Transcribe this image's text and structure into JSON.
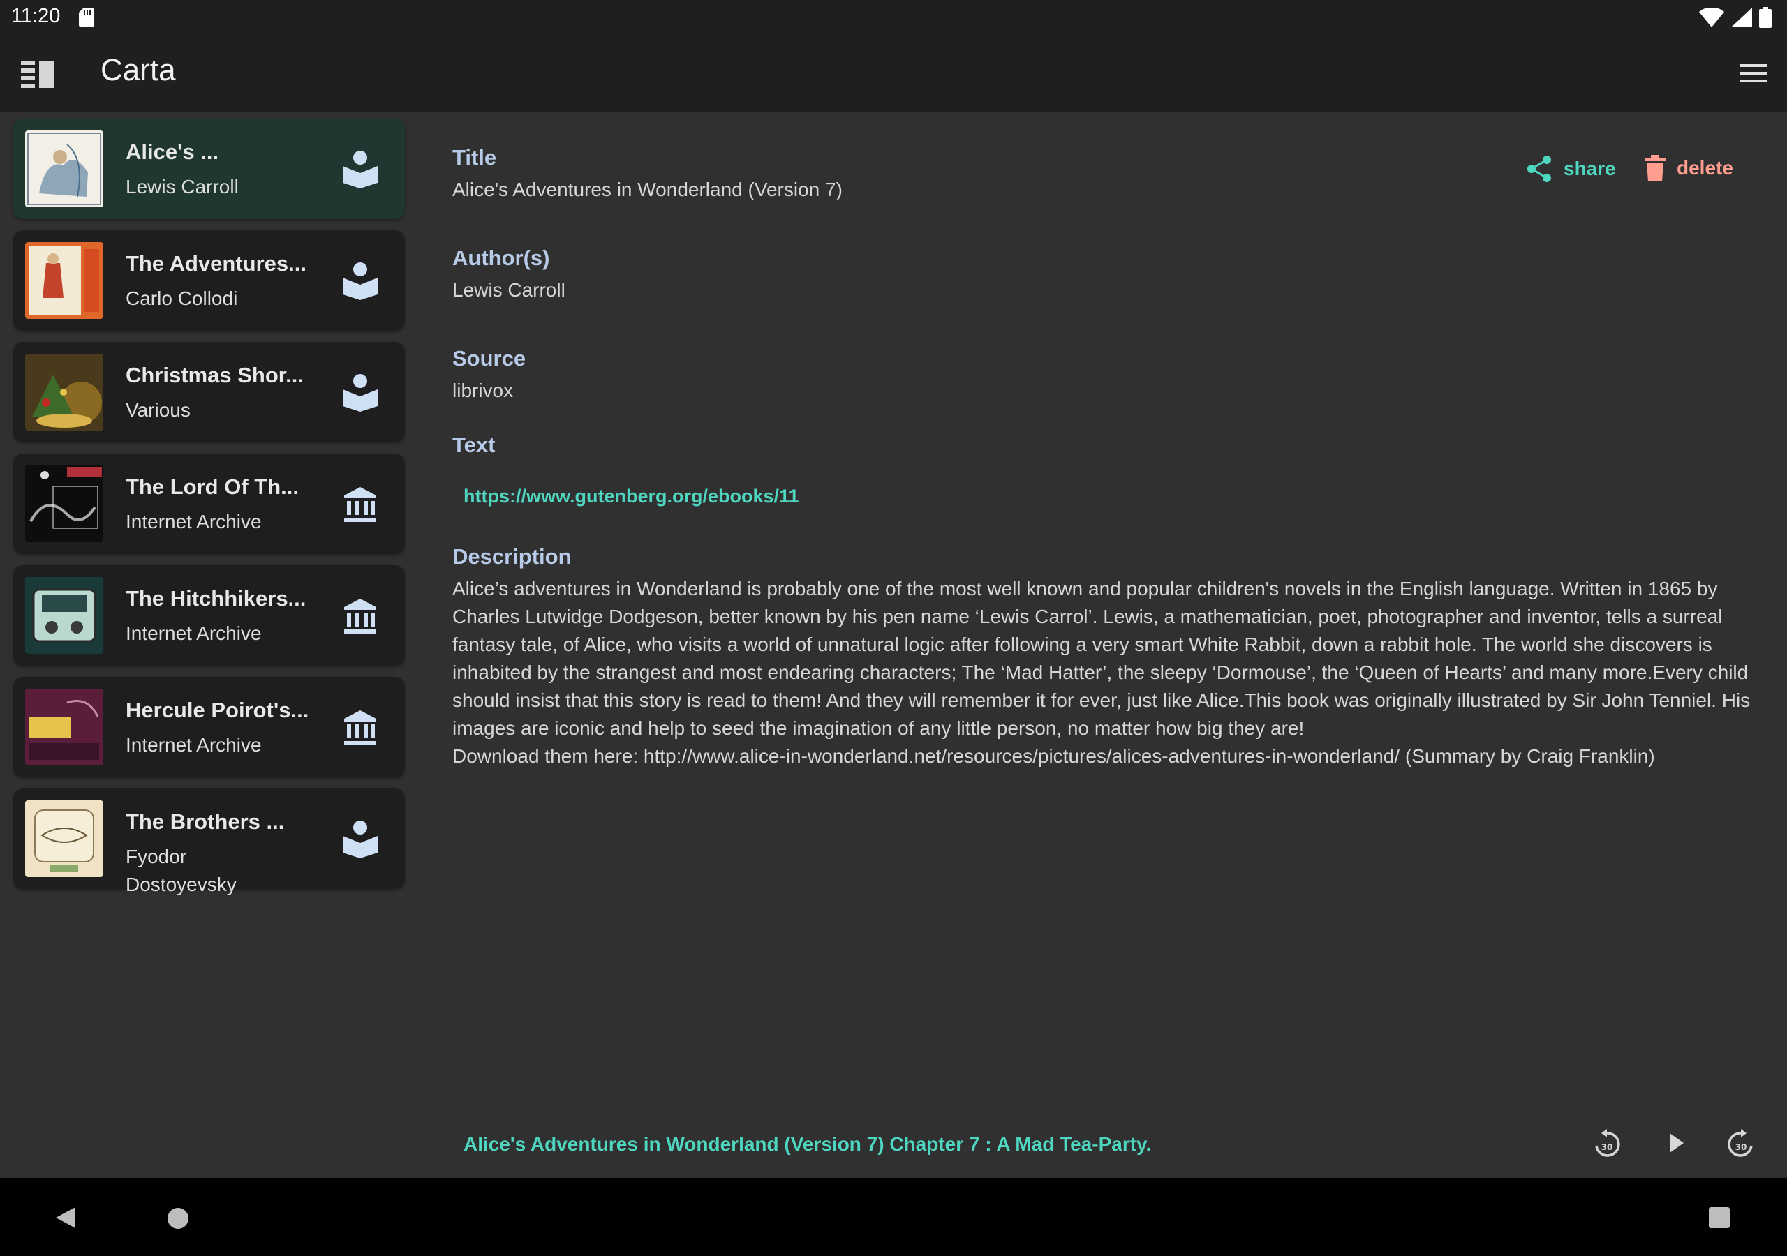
{
  "status_bar": {
    "time": "11:20"
  },
  "app_bar": {
    "title": "Carta"
  },
  "books": [
    {
      "title": "Alice's ...",
      "subtitle": "Lewis Carroll",
      "source_icon": "reader-icon",
      "selected": true
    },
    {
      "title": "The Adventures...",
      "subtitle": "Carlo Collodi",
      "source_icon": "reader-icon",
      "selected": false
    },
    {
      "title": "Christmas Shor...",
      "subtitle": "Various",
      "source_icon": "reader-icon",
      "selected": false
    },
    {
      "title": "The Lord Of Th...",
      "subtitle": "Internet Archive",
      "source_icon": "archive-icon",
      "selected": false
    },
    {
      "title": "The Hitchhikers...",
      "subtitle": "Internet Archive",
      "source_icon": "archive-icon",
      "selected": false
    },
    {
      "title": "Hercule Poirot's...",
      "subtitle": "Internet Archive",
      "source_icon": "archive-icon",
      "selected": false
    },
    {
      "title": "The Brothers ...",
      "subtitle": "Fyodor Dostoyevsky",
      "source_icon": "reader-icon",
      "selected": false
    }
  ],
  "detail": {
    "title_label": "Title",
    "title_value": "Alice's Adventures in Wonderland (Version 7)",
    "authors_label": "Author(s)",
    "authors_value": "Lewis Carroll",
    "source_label": "Source",
    "source_value": "librivox",
    "text_label": "Text",
    "text_link": "https://www.gutenberg.org/ebooks/11",
    "description_label": "Description",
    "description_value": "Alice’s adventures in Wonderland is probably one of the most well known and popular children's novels in the English language. Written in 1865 by Charles Lutwidge Dodgeson, better known by his pen name ‘Lewis Carrol’. Lewis, a mathematician, poet, photographer and inventor, tells a surreal fantasy tale, of Alice, who visits a world of unnatural logic after following a very smart White Rabbit, down a rabbit hole. The world she discovers is inhabited by the strangest and most endearing characters; The ‘Mad Hatter’, the sleepy ‘Dormouse’, the ‘Queen of Hearts’ and many more.Every child should insist that this story is read to them! And they will remember it for ever, just like Alice.This book was originally illustrated by Sir John Tenniel. His images are iconic and help to seed the imagination of any little person, no matter how big they are!\nDownload them here: http://www.alice-in-wonderland.net/resources/pictures/alices-adventures-in-wonderland/ (Summary by Craig Franklin)",
    "share_label": "share",
    "delete_label": "delete"
  },
  "player": {
    "now_playing": "Alice's Adventures in Wonderland (Version 7) Chapter 7 : A Mad Tea-Party.",
    "rewind_seconds": "30",
    "forward_seconds": "30"
  },
  "colors": {
    "accent": "#4fd6c1",
    "delete": "#ff9d8f",
    "label": "#b7cbe9",
    "selected_card": "#203630",
    "card": "#1e1e1e",
    "background": "#303030"
  }
}
